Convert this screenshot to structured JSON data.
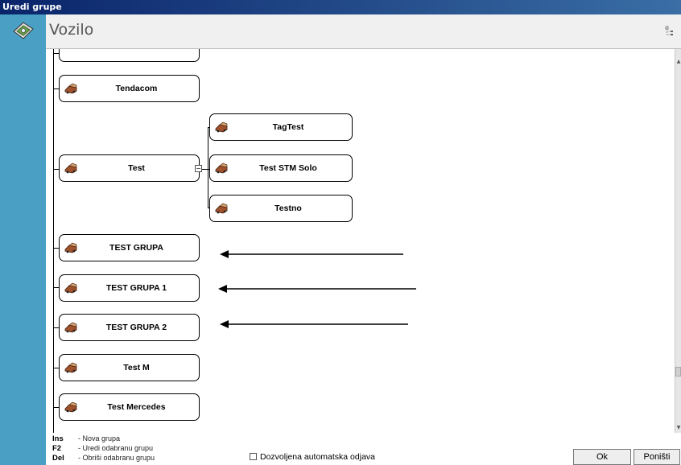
{
  "window": {
    "title": "Uredi grupe"
  },
  "header": {
    "title": "Vozilo",
    "icon": "vehicle-group-icon",
    "toggle_icon": "tree-toggle-icon"
  },
  "tree": {
    "root_nodes": [
      {
        "label": ""
      },
      {
        "label": "Tendacom"
      },
      {
        "label": "Test"
      },
      {
        "label": "TEST GRUPA"
      },
      {
        "label": "TEST GRUPA 1"
      },
      {
        "label": "TEST GRUPA 2"
      },
      {
        "label": "Test M"
      },
      {
        "label": "Test Mercedes"
      }
    ],
    "test_children": [
      {
        "label": "TagTest"
      },
      {
        "label": "Test STM Solo"
      },
      {
        "label": "Testno"
      }
    ],
    "expand_symbol": "−"
  },
  "shortcuts": [
    {
      "key": "Ins",
      "desc": "- Nova grupa"
    },
    {
      "key": "F2",
      "desc": "- Uredi odabranu grupu"
    },
    {
      "key": "Del",
      "desc": "- Obriši odabranu grupu"
    }
  ],
  "auto_logout": {
    "label": "Dozvoljena automatska odjava",
    "checked": false
  },
  "buttons": {
    "ok": "Ok",
    "cancel": "Poništi"
  },
  "colors": {
    "titlebar": "#0a246a",
    "side_strip": "#4aa0c4",
    "node_border": "#000000"
  }
}
